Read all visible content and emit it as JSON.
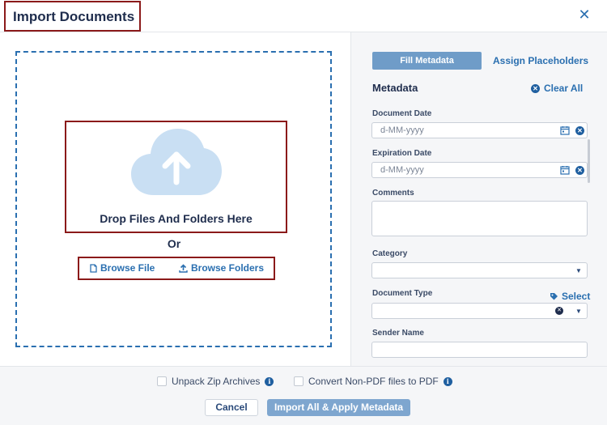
{
  "dialog": {
    "title": "Import Documents",
    "close_icon": "close-icon"
  },
  "dropzone": {
    "drop_text": "Drop Files And Folders Here",
    "or_text": "Or",
    "browse_file": "Browse File",
    "browse_folders": "Browse Folders",
    "icon": "cloud-upload-icon"
  },
  "metadata_panel": {
    "tabs": [
      {
        "label": "Fill Metadata",
        "active": true
      },
      {
        "label": "Assign Placeholders",
        "active": false
      }
    ],
    "heading": "Metadata",
    "clear_all": "Clear All",
    "fields": {
      "document_date": {
        "label": "Document Date",
        "placeholder": "d-MM-yyyy"
      },
      "expiration_date": {
        "label": "Expiration Date",
        "placeholder": "d-MM-yyyy"
      },
      "comments": {
        "label": "Comments"
      },
      "category": {
        "label": "Category"
      },
      "document_type": {
        "label": "Document Type",
        "select_link": "Select"
      },
      "sender_name": {
        "label": "Sender Name"
      }
    }
  },
  "footer": {
    "unpack_zip": "Unpack Zip Archives",
    "convert_pdf": "Convert Non-PDF files to PDF",
    "cancel": "Cancel",
    "import": "Import All & Apply Metadata"
  },
  "colors": {
    "accent": "#2a6fb0",
    "highlight_border": "#8b1a1a",
    "primary_button": "#7ea6cf"
  }
}
